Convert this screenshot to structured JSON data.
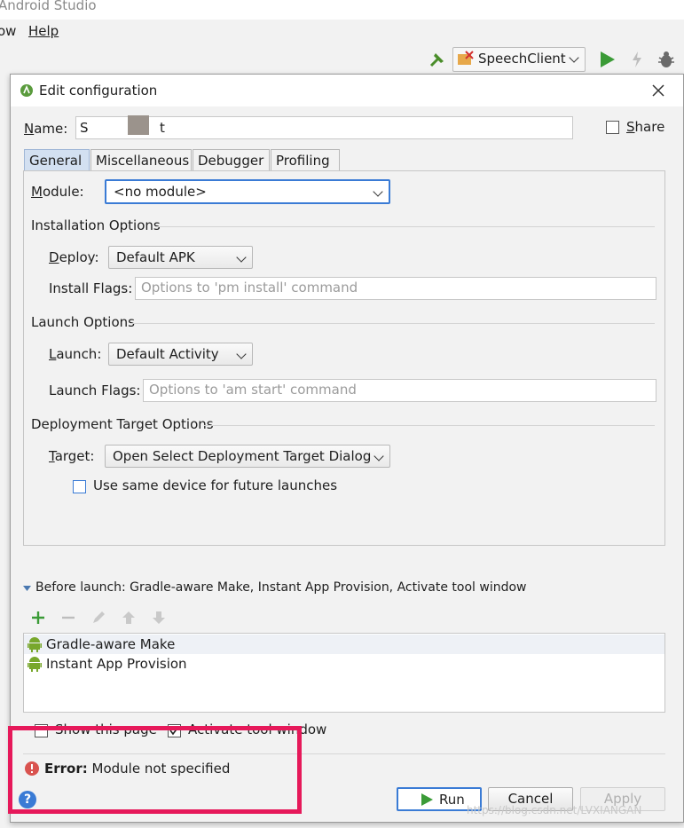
{
  "app": {
    "title": "Android Studio"
  },
  "menu": [
    "ow",
    "Help"
  ],
  "toolbar": {
    "run_config": "SpeechClient"
  },
  "dialog": {
    "title": "Edit configuration",
    "name_label": "Name:",
    "name_value": "S t",
    "share_label": "Share",
    "tabs": [
      "General",
      "Miscellaneous",
      "Debugger",
      "Profiling"
    ],
    "module_label": "Module:",
    "module_value": "<no module>",
    "installation": {
      "heading": "Installation Options",
      "deploy_label": "Deploy:",
      "deploy_value": "Default APK",
      "flags_label": "Install Flags:",
      "flags_placeholder": "Options to 'pm install' command"
    },
    "launch": {
      "heading": "Launch Options",
      "launch_label": "Launch:",
      "launch_value": "Default Activity",
      "flags_label": "Launch Flags:",
      "flags_placeholder": "Options to 'am start' command"
    },
    "deployment": {
      "heading": "Deployment Target Options",
      "target_label": "Target:",
      "target_value": "Open Select Deployment Target Dialog",
      "same_device_label": "Use same device for future launches"
    },
    "before_launch": {
      "heading": "Before launch: Gradle-aware Make, Instant App Provision, Activate tool window",
      "items": [
        "Gradle-aware Make",
        "Instant App Provision"
      ]
    },
    "show_page_label": "Show this page",
    "activate_tool_label": "Activate tool window",
    "error": {
      "prefix": "Error:",
      "message": "Module not specified"
    },
    "buttons": {
      "run": "Run",
      "cancel": "Cancel",
      "apply": "Apply"
    },
    "help_label": "?",
    "watermark": "https://blog.csdn.net/LVXIANGAN"
  },
  "colors": {
    "highlight_box": "#e6195a",
    "accent": "#3a7bd5",
    "error": "#d9534f",
    "android_green": "#78a72c"
  }
}
